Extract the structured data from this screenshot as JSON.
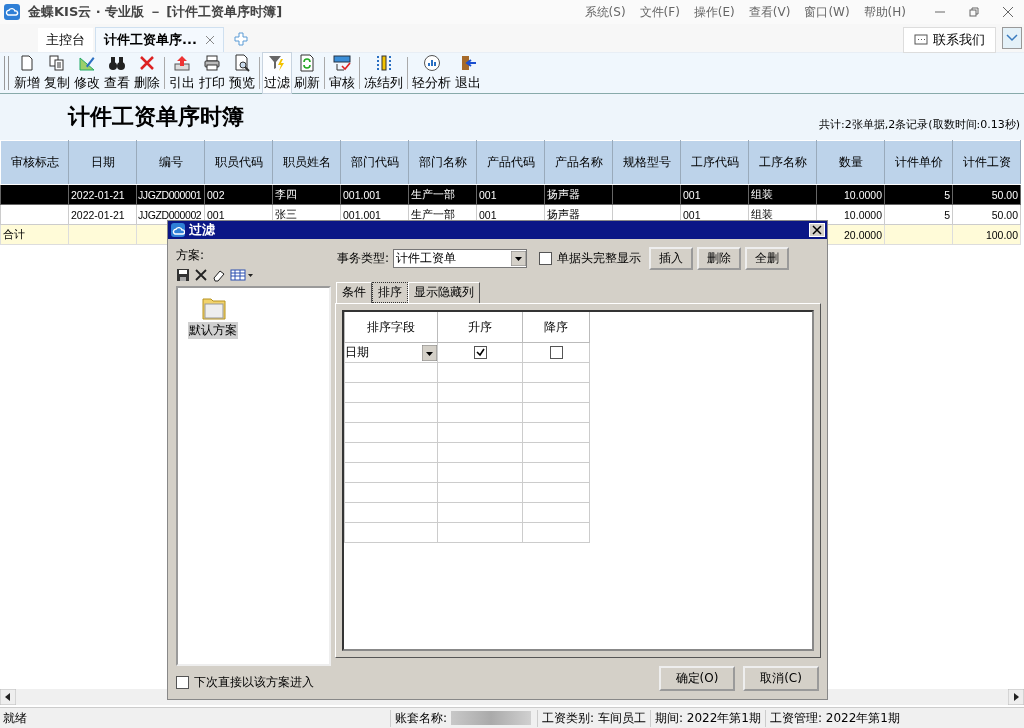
{
  "window": {
    "title": "金蝶KIS云 · 专业版 － [计件工资单序时簿]"
  },
  "menu": [
    "系统(S)",
    "文件(F)",
    "操作(E)",
    "查看(V)",
    "窗口(W)",
    "帮助(H)"
  ],
  "tabs": [
    {
      "label": "主控台",
      "selected": false
    },
    {
      "label": "计件工资单序...",
      "selected": true,
      "closable": true
    }
  ],
  "contact_button": "联系我们",
  "toolbar": [
    [
      {
        "label": "新增"
      },
      {
        "label": "复制"
      },
      {
        "label": "修改"
      },
      {
        "label": "查看"
      },
      {
        "label": "删除"
      }
    ],
    [
      {
        "label": "引出"
      },
      {
        "label": "打印"
      },
      {
        "label": "预览"
      }
    ],
    [
      {
        "label": "过滤",
        "pressed": true
      },
      {
        "label": "刷新",
        "pressed": false
      }
    ],
    [
      {
        "label": "审核"
      }
    ],
    [
      {
        "label": "冻结列"
      }
    ],
    [
      {
        "label": "轻分析"
      },
      {
        "label": "退出"
      }
    ]
  ],
  "report": {
    "title": "计件工资单序时簿",
    "summary": "共计:2张单据,2条记录(取数时间:0.13秒)"
  },
  "table": {
    "columns": [
      "审核标志",
      "日期",
      "编号",
      "职员代码",
      "职员姓名",
      "部门代码",
      "部门名称",
      "产品代码",
      "产品名称",
      "规格型号",
      "工序代码",
      "工序名称",
      "数量",
      "计件单价",
      "计件工资"
    ],
    "rows": [
      {
        "selected": true,
        "cells": [
          null,
          "2022-01-21",
          "JJGZD000001",
          "002",
          "李四",
          "001.001",
          "生产一部",
          "001",
          "扬声器",
          null,
          "001",
          "组装",
          "10.0000",
          "5",
          "50.00"
        ]
      },
      {
        "selected": false,
        "cells": [
          null,
          "2022-01-21",
          "JJGZD000002",
          "001",
          "张三",
          "001.001",
          "生产一部",
          "001",
          "扬声器",
          null,
          "001",
          "组装",
          "10.0000",
          "5",
          "50.00"
        ]
      }
    ],
    "total": {
      "cells": [
        "合计",
        null,
        null,
        null,
        null,
        null,
        null,
        null,
        null,
        null,
        null,
        null,
        "20.0000",
        null,
        "100.00"
      ]
    }
  },
  "dialog": {
    "title": "过滤",
    "scheme_label": "方案:",
    "schemes": [
      {
        "label": "默认方案",
        "selected": true
      }
    ],
    "type_label": "事务类型:",
    "type_value": "计件工资单",
    "full_header": {
      "label": "单据头完整显示",
      "checked": false
    },
    "action_buttons": [
      "插入",
      "删除",
      "全删"
    ],
    "tabs": [
      {
        "label": "条件",
        "selected": false
      },
      {
        "label": "排序",
        "selected": true
      },
      {
        "label": "显示隐藏列",
        "selected": false
      }
    ],
    "sort_columns": [
      "排序字段",
      "升序",
      "降序"
    ],
    "sort_rows": [
      {
        "field": "日期",
        "ascending": true,
        "descending": false
      }
    ],
    "direct_entry": {
      "label": "下次直接以该方案进入",
      "checked": false
    },
    "ok": "确定(O)",
    "cancel": "取消(C)"
  },
  "status": {
    "ready": "就绪",
    "account_label": "账套名称:",
    "category": "工资类别: 车间员工",
    "period": "期间: 2022年第1期",
    "payroll": "工资管理: 2022年第1期"
  }
}
